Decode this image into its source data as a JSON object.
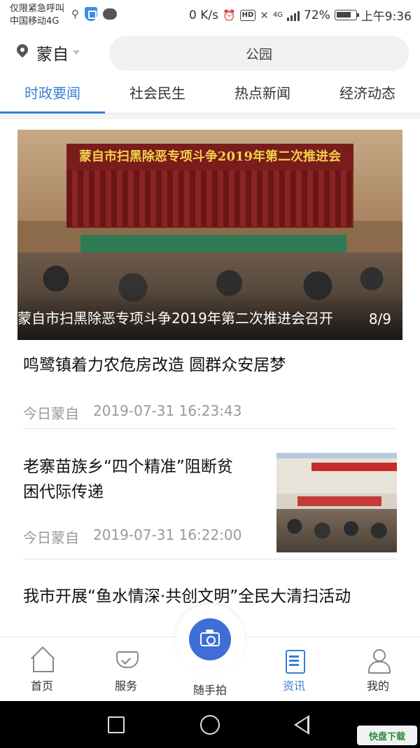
{
  "status_bar": {
    "line1": "仅限紧急呼叫",
    "line2": "中国移动4G",
    "speed": "0 K/s",
    "hd": "HD",
    "network": "4G",
    "battery": "72%",
    "time": "上午9:36"
  },
  "header": {
    "location": "蒙自",
    "search_placeholder": "公园"
  },
  "tabs": [
    {
      "label": "时政要闻",
      "active": true
    },
    {
      "label": "社会民生",
      "active": false
    },
    {
      "label": "热点新闻",
      "active": false
    },
    {
      "label": "经济动态",
      "active": false
    }
  ],
  "banner": {
    "image_heading": "蒙自市扫黑除恶专项斗争2019年第二次推进会",
    "caption": "蒙自市扫黑除恶专项斗争2019年第二次推进会召开",
    "counter": "8/9"
  },
  "news": [
    {
      "title": "鸣鹭镇着力农危房改造 圆群众安居梦",
      "source": "今日蒙自",
      "time": "2019-07-31 16:23:43"
    },
    {
      "title_line1": "老寨苗族乡“四个精准”阻断贫",
      "title_line2": "困代际传递",
      "source": "今日蒙自",
      "time": "2019-07-31 16:22:00"
    },
    {
      "title": "我市开展“鱼水情深·共创文明”全民大清扫活动"
    }
  ],
  "tabbar": {
    "home": "首页",
    "service": "服务",
    "camera": "随手拍",
    "news": "资讯",
    "mine": "我的"
  },
  "watermark": "快盘下载",
  "colors": {
    "accent": "#3a7fd5",
    "camera": "#3f6fd6"
  }
}
